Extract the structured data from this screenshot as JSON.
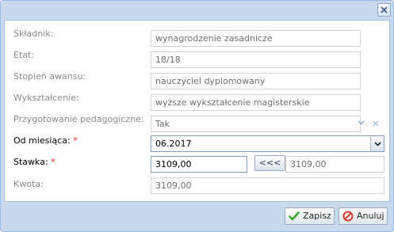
{
  "dialog": {
    "close_icon": "close-icon"
  },
  "form": {
    "skladnik": {
      "label": "Składnik:",
      "value": "wynagrodzenie zasadnicze"
    },
    "etat": {
      "label": "Etat:",
      "value": "18/18"
    },
    "stopien": {
      "label": "Stopień awansu:",
      "value": "nauczyciel dyplomowany"
    },
    "wyksztalcenie": {
      "label": "Wykształcenie:",
      "value": "wyższe wykształcenie magisterskie"
    },
    "przygotowanie": {
      "label": "Przygotowanie pedagogiczne:",
      "value": "Tak"
    },
    "od_miesiaca": {
      "label": "Od miesiąca:",
      "required_mark": "*",
      "value": "06.2017"
    },
    "stawka": {
      "label": "Stawka:",
      "required_mark": "*",
      "value": "3109,00",
      "copy_label": "<<<",
      "reference_value": "3109,00"
    },
    "kwota": {
      "label": "Kwota:",
      "value": "3109,00"
    }
  },
  "buttons": {
    "save_label": "Zapisz",
    "cancel_label": "Anuluj"
  },
  "colors": {
    "frame": "#c9d9ec",
    "required": "#e02020",
    "save_icon": "#3da52b",
    "cancel_icon": "#d23a2a"
  }
}
